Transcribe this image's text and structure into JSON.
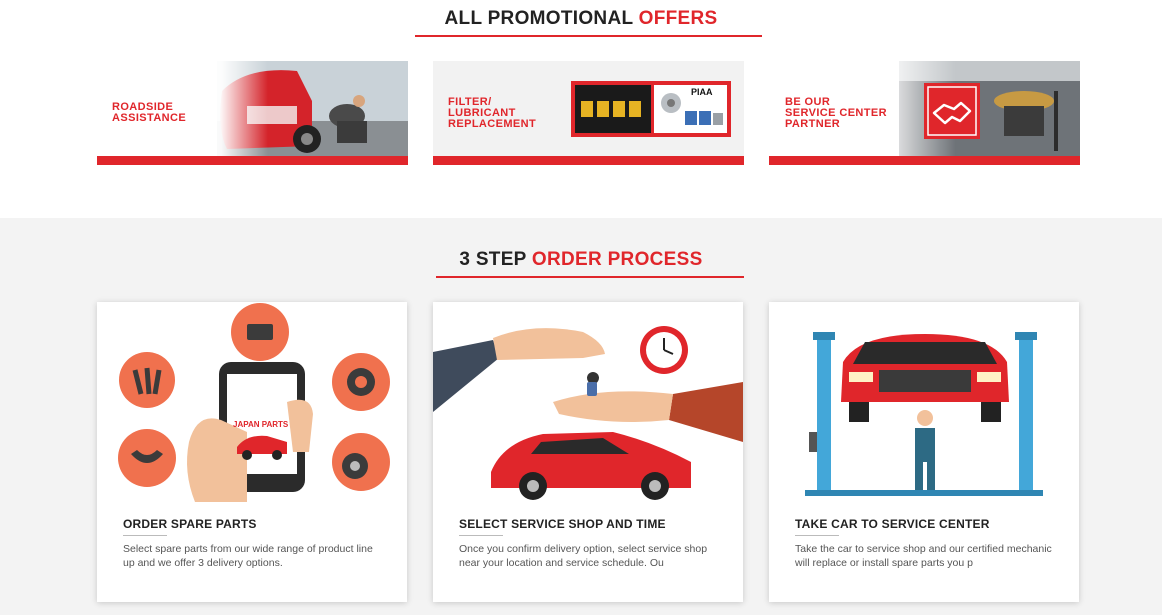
{
  "promotions": {
    "title_plain": "ALL PROMOTIONAL ",
    "title_accent": "OFFERS",
    "items": [
      {
        "label": "ROADSIDE\nASSISTANCE"
      },
      {
        "label": "FILTER/\nLUBRICANT\nREPLACEMENT",
        "brand": "PIAA"
      },
      {
        "label": "BE OUR\nSERVICE CENTER\nPARTNER"
      }
    ]
  },
  "process": {
    "title_plain": "3 STEP ",
    "title_accent": "ORDER PROCESS",
    "steps": [
      {
        "title": "ORDER SPARE PARTS",
        "description": "Select spare parts from our wide range of product line up and we offer 3 delivery options.",
        "phone_brand": "JAPAN PARTS"
      },
      {
        "title": "SELECT SERVICE SHOP AND TIME",
        "description": "Once you confirm delivery option, select service shop near your location and service schedule. Ou"
      },
      {
        "title": "TAKE CAR TO SERVICE CENTER",
        "description": "Take the car to service shop and our certified mechanic will replace or install spare parts you p"
      }
    ]
  },
  "colors": {
    "accent": "#e0262b",
    "dark": "#222222",
    "section_bg": "#f3f3f3"
  }
}
